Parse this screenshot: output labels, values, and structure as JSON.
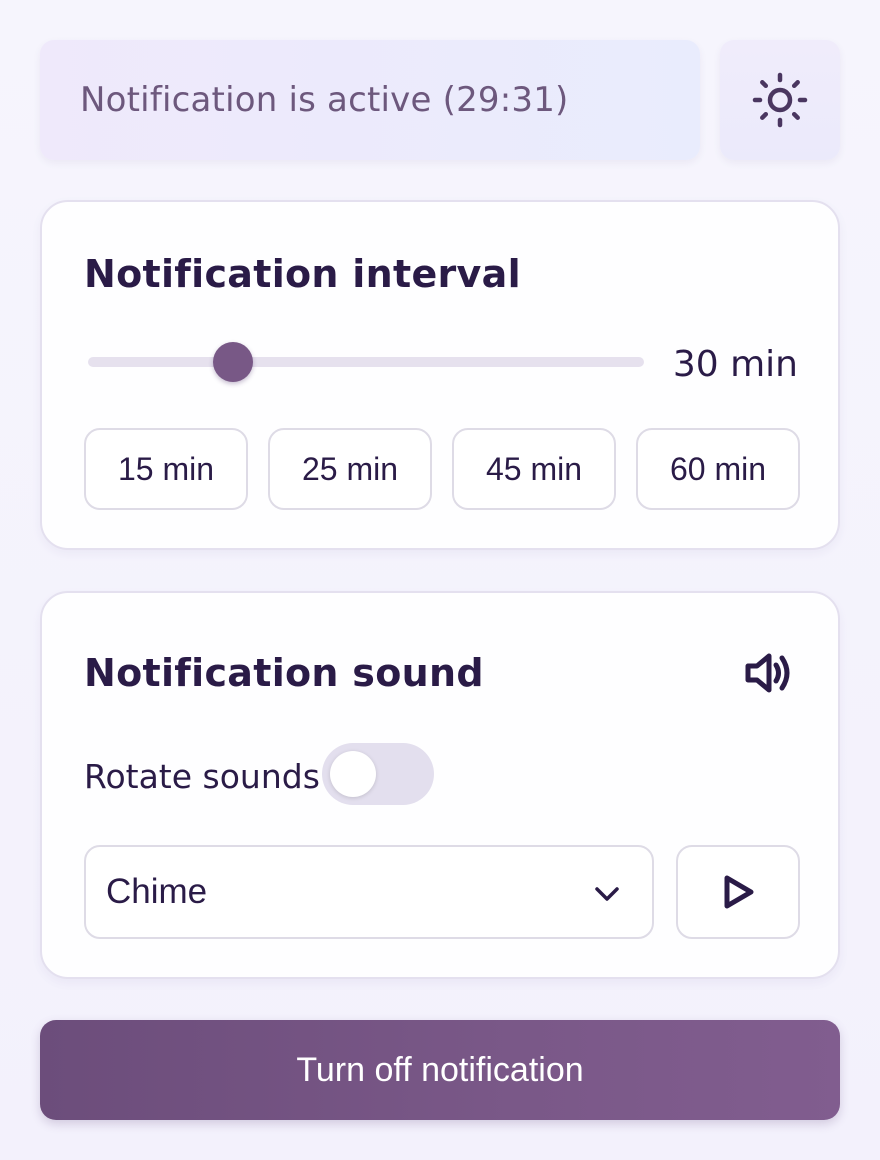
{
  "status": {
    "text": "Notification is active (29:31)"
  },
  "theme_toggle": {
    "icon": "sun-icon"
  },
  "interval": {
    "title": "Notification interval",
    "slider_value_fraction": 0.26,
    "value_label": "30 min",
    "presets": [
      "15 min",
      "25 min",
      "45 min",
      "60 min"
    ]
  },
  "sound": {
    "title": "Notification sound",
    "speaker_icon": "speaker-icon",
    "rotate_label": "Rotate sounds",
    "rotate_on": false,
    "selected_sound": "Chime",
    "play_icon": "play-icon"
  },
  "action": {
    "turn_off_label": "Turn off notification"
  },
  "colors": {
    "accent": "#785886",
    "text": "#2a1b47",
    "button_gradient_start": "#6c4d7b",
    "button_gradient_end": "#815d8f"
  }
}
